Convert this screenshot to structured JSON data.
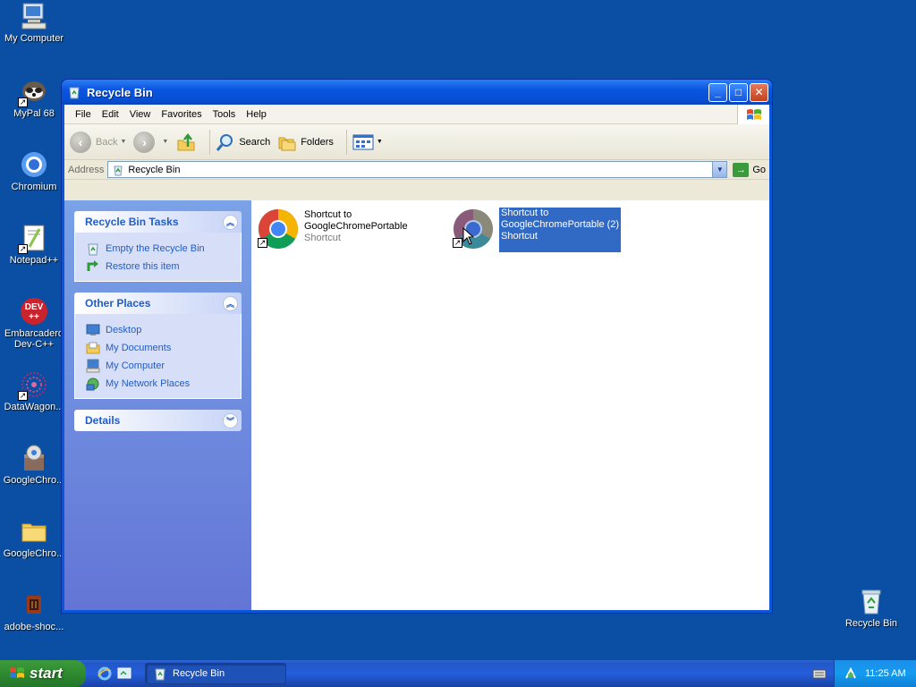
{
  "desktop": {
    "icons": [
      {
        "label": "My Computer",
        "icon": "my-computer-icon"
      },
      {
        "label": "MyPal 68",
        "icon": "mypal-icon"
      },
      {
        "label": "Chromium",
        "icon": "chromium-icon"
      },
      {
        "label": "Notepad++",
        "icon": "notepad-plus-plus-icon"
      },
      {
        "label": "Embarcadero Dev-C++",
        "label_line1": "Embarcadero",
        "label_line2": "Dev-C++",
        "icon": "devcpp-icon"
      },
      {
        "label": "DataWagon...",
        "icon": "datawagon-icon"
      },
      {
        "label": "GoogleChro...",
        "icon": "chrome-installer-icon"
      },
      {
        "label": "GoogleChro...",
        "icon": "folder-icon"
      },
      {
        "label": "adobe-shoc...",
        "icon": "adobe-shockwave-icon"
      },
      {
        "label": "Recycle Bin",
        "icon": "recycle-bin-icon"
      }
    ],
    "devcpp_badge": "DEV",
    "devcpp_badge2": "++"
  },
  "window": {
    "title": "Recycle Bin",
    "menu": [
      "File",
      "Edit",
      "View",
      "Favorites",
      "Tools",
      "Help"
    ],
    "toolbar": {
      "back": "Back",
      "search": "Search",
      "folders": "Folders"
    },
    "address": {
      "label": "Address",
      "value": "Recycle Bin",
      "go": "Go"
    },
    "tasks_panel": {
      "title": "Recycle Bin Tasks",
      "items": [
        "Empty the Recycle Bin",
        "Restore this item"
      ]
    },
    "places_panel": {
      "title": "Other Places",
      "items": [
        "Desktop",
        "My Documents",
        "My Computer",
        "My Network Places"
      ]
    },
    "details_panel": {
      "title": "Details"
    },
    "files": [
      {
        "line1": "Shortcut to",
        "line2": "GoogleChromePortable",
        "type": "Shortcut",
        "selected": false
      },
      {
        "line1": "Shortcut to",
        "line2": "GoogleChromePortable (2)",
        "type": "Shortcut",
        "selected": true
      }
    ]
  },
  "taskbar": {
    "start": "start",
    "task": "Recycle Bin",
    "clock": "11:25 AM"
  },
  "colors": {
    "desktop": "#0a4fa3",
    "titlebar": "#0a55e0",
    "selection": "#316ac5",
    "panel_link": "#215dc6"
  }
}
